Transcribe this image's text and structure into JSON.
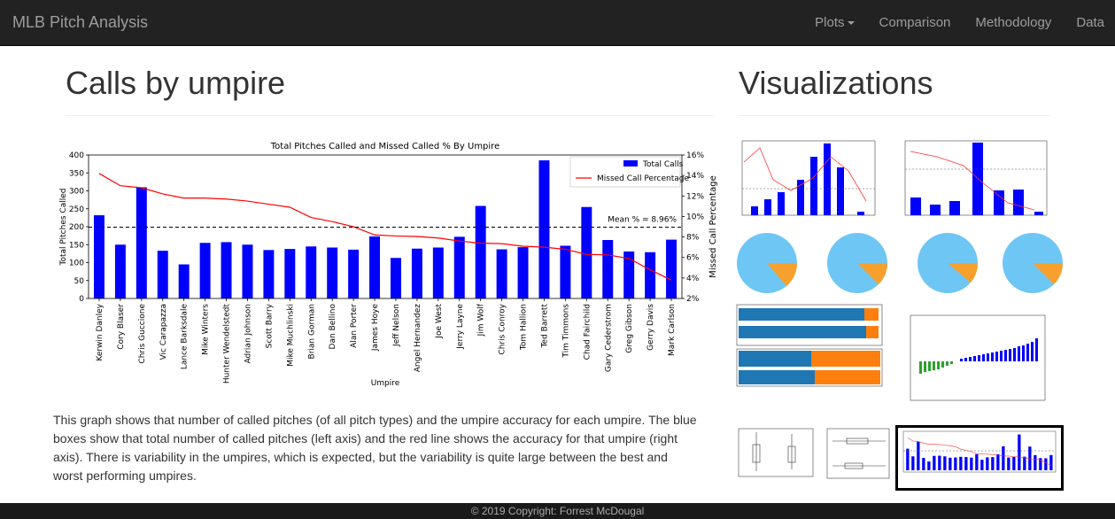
{
  "navbar": {
    "brand": "MLB Pitch Analysis",
    "items": [
      {
        "label": "Plots",
        "dropdown": true
      },
      {
        "label": "Comparison"
      },
      {
        "label": "Methodology"
      },
      {
        "label": "Data"
      }
    ]
  },
  "main": {
    "title": "Calls by umpire",
    "description": "This graph shows that number of called pitches (of all pitch types) and the umpire accuracy for each umpire. The blue boxes show that total number of called pitches (left axis) and the red line shows the accuracy for that umpire (right axis). There is variability in the umpires, which is expected, but the variability is quite large between the best and worst performing umpires."
  },
  "sidebar": {
    "title": "Visualizations"
  },
  "footer": {
    "text": "© 2019 Copyright: Forrest McDougal"
  },
  "colors": {
    "bar": "#0000ff",
    "line": "#ff0000",
    "pie_blue": "#6ec6f5",
    "pie_orange": "#f7a02d",
    "green": "#2ca02c",
    "navbar": "#222222"
  },
  "chart_data": {
    "type": "bar",
    "title": "Total Pitches Called and Missed Called % By Umpire",
    "xlabel": "Umpire",
    "ylabel": "Total Pitches Called",
    "y2label": "Missed Call Percentage",
    "ylim": [
      0,
      400
    ],
    "y2lim": [
      2,
      16
    ],
    "yticks": [
      "0",
      "50",
      "100",
      "150",
      "200",
      "250",
      "300",
      "350",
      "400"
    ],
    "y2ticks": [
      "2%",
      "4%",
      "6%",
      "8%",
      "10%",
      "12%",
      "14%",
      "16%"
    ],
    "categories": [
      "Kerwin Danley",
      "Cory Blaser",
      "Chris Guccione",
      "Vic Carapazza",
      "Lance Barksdale",
      "Mike Winters",
      "Hunter Wendelstedt",
      "Adrian Johnson",
      "Scott Barry",
      "Mike Muchlinski",
      "Brian Gorman",
      "Dan Bellino",
      "Alan Porter",
      "James Hoye",
      "Jeff Nelson",
      "Angel Hernandez",
      "Joe West",
      "Jerry Layne",
      "Jim Wolf",
      "Chris Conroy",
      "Tom Hallion",
      "Ted Barrett",
      "Tim Timmons",
      "Chad Fairchild",
      "Gary Cederstrom",
      "Greg Gibson",
      "Gerry Davis",
      "Mark Carlson"
    ],
    "series": [
      {
        "name": "Total Calls",
        "type": "bar",
        "axis": "left",
        "values": [
          232,
          150,
          310,
          133,
          95,
          155,
          157,
          150,
          135,
          138,
          145,
          142,
          136,
          173,
          113,
          139,
          142,
          172,
          258,
          137,
          143,
          385,
          147,
          255,
          163,
          131,
          129,
          164
        ]
      },
      {
        "name": "Missed Call Percentage",
        "type": "line",
        "axis": "right",
        "values": [
          14.2,
          13.0,
          12.8,
          12.2,
          11.8,
          11.8,
          11.7,
          11.5,
          11.2,
          10.9,
          9.9,
          9.5,
          9.0,
          8.2,
          8.1,
          8.05,
          7.9,
          7.6,
          7.4,
          7.35,
          7.1,
          7.0,
          6.8,
          6.3,
          6.25,
          5.9,
          4.8,
          3.8
        ]
      }
    ],
    "reference_line": {
      "value": 8.96,
      "axis": "right",
      "label": "Mean % = 8.96%"
    },
    "legend": "top-right",
    "grid": false
  },
  "thumbnails": [
    {
      "name": "thumb-pitch-count",
      "selected": false
    },
    {
      "name": "thumb-pitch-type",
      "selected": false
    },
    {
      "name": "thumb-pie-1",
      "selected": false
    },
    {
      "name": "thumb-pie-2",
      "selected": false
    },
    {
      "name": "thumb-pie-3",
      "selected": false
    },
    {
      "name": "thumb-pie-4",
      "selected": false
    },
    {
      "name": "thumb-home-away",
      "selected": false
    },
    {
      "name": "thumb-leading-pitches",
      "selected": false
    },
    {
      "name": "thumb-boxplot-1",
      "selected": false
    },
    {
      "name": "thumb-boxplot-2",
      "selected": false
    },
    {
      "name": "thumb-umpire",
      "selected": true
    }
  ]
}
